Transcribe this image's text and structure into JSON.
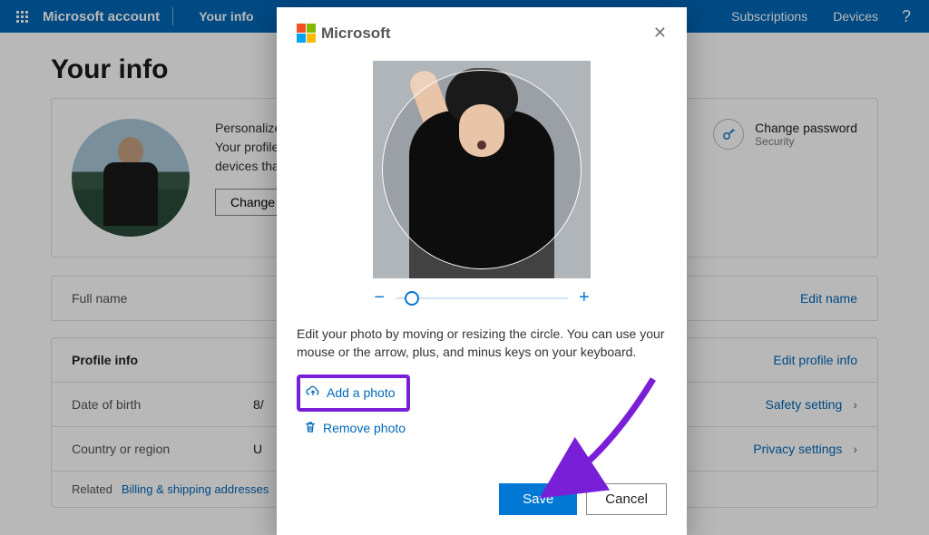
{
  "topbar": {
    "brand": "Microsoft account",
    "nav_active": "Your info",
    "nav_item_subscriptions": "Subscriptions",
    "nav_item_devices": "Devices"
  },
  "page": {
    "title": "Your info"
  },
  "profile_panel": {
    "blurb_line1": "Personalize your account with a photo.",
    "blurb_line2": "Your profile photo will appear on apps and",
    "blurb_line3": "devices that use your Microsoft account.",
    "change_button": "Change photo",
    "change_password_title": "Change password",
    "change_password_sub": "Security"
  },
  "rows": {
    "full_name_label": "Full name",
    "edit_name": "Edit name",
    "profile_info_label": "Profile info",
    "edit_profile_info": "Edit profile info",
    "dob_label": "Date of birth",
    "dob_value": "8/",
    "dob_action": "Safety setting",
    "country_label": "Country or region",
    "country_value": "U",
    "country_action": "Privacy settings",
    "related_label": "Related",
    "related_link": "Billing & shipping addresses"
  },
  "modal": {
    "brand": "Microsoft",
    "instruction": "Edit your photo by moving or resizing the circle. You can use your mouse or the arrow, plus, and minus keys on your keyboard.",
    "add_photo": "Add a photo",
    "remove_photo": "Remove photo",
    "save": "Save",
    "cancel": "Cancel"
  },
  "colors": {
    "primary": "#0078d4",
    "annotation": "#7a1fd8"
  }
}
